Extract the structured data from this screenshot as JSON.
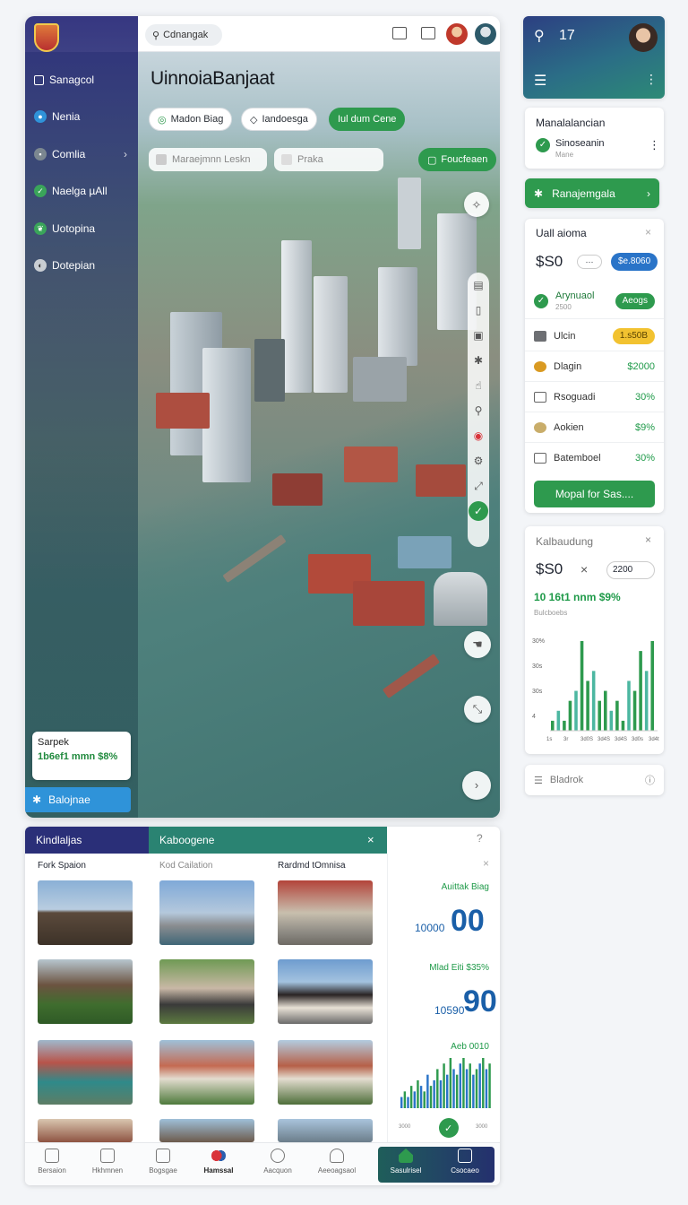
{
  "sidebar": {
    "items": [
      {
        "label": "Sanagcol",
        "icon": "home-icon"
      },
      {
        "label": "Nenia",
        "icon": "user-icon"
      },
      {
        "label": "Comlia",
        "icon": "grid-icon"
      },
      {
        "label": "Naelga µAll",
        "icon": "shield-icon"
      },
      {
        "label": "Uotopina",
        "icon": "leaf-icon"
      },
      {
        "label": "Dotepian",
        "icon": "globe-icon"
      }
    ],
    "promo_title": "Sarpek",
    "promo_value": "1b6ef1 mmn $8%",
    "button_label": "Balojnae"
  },
  "topbar": {
    "search_placeholder": "Cdnangak"
  },
  "main": {
    "title": "UinnoiaBanjaat",
    "chips": [
      "Madon Biag",
      "Iandoesga",
      "Iul dum Cene"
    ],
    "field1": "Maraejmnn Leskn",
    "field2": "Praka",
    "action_button": "Foucfeaen"
  },
  "right": {
    "top_title": "17",
    "card1_title": "Manalalancian",
    "card1_item": "Sinoseanin",
    "card1_sub": "Mane",
    "green_button": "Ranajemgala",
    "list_title": "Uall aioma",
    "price": "$S0",
    "price_badge": "$e.8060",
    "rows": [
      {
        "label": "Arynuaol",
        "sub": "2500",
        "value": "Aeogs",
        "type": "pill-green"
      },
      {
        "label": "Ulcin",
        "value": "1.s50B",
        "type": "pill-yellow"
      },
      {
        "label": "Dlagin",
        "value": "$2000",
        "type": "text"
      },
      {
        "label": "Rsoguadi",
        "value": "30%",
        "type": "text"
      },
      {
        "label": "Aokien",
        "value": "$9%",
        "type": "text"
      },
      {
        "label": "Batemboel",
        "value": "30%",
        "type": "text"
      }
    ],
    "cta": "Mopal for Sas....",
    "chart_card_title": "Kalbaudung",
    "chart_price": "$S0",
    "chart_input": "2200",
    "chart_value": "10 16t1 nnm $9%",
    "chart_sub": "Bulcboebs",
    "footer_label": "Bladrok"
  },
  "bottom": {
    "tab1": "Kindlaljas",
    "tab2": "Kaboogene",
    "col1_title": "Fork Spaion",
    "col2_title": "Kod Cailation",
    "col3_title": "Rardmd tOmnisa",
    "stat1_label": "Auittak Biag",
    "stat1_small": "10000",
    "stat1_big": "00",
    "stat2_label": "Mlad Eiti $35%",
    "stat2_small": "10590",
    "stat2_big": "90",
    "stat3_label": "Aeb 0010",
    "nav": [
      "Bersaion",
      "Hkhmnen",
      "Bogsgae",
      "Hamssal",
      "Aacquon",
      "Aeeoagsaol",
      "Sasulrisel",
      "Csocaeo"
    ]
  },
  "chart_data": [
    {
      "type": "bar",
      "title": "",
      "y_ticks": [
        "30%",
        "30s",
        "30s",
        "4"
      ],
      "x_ticks": [
        "1s",
        "3r",
        "3d0S",
        "3d4S",
        "3d4S",
        "3d0s",
        "3d4t"
      ],
      "values": [
        1,
        2,
        1,
        3,
        4,
        9,
        5,
        6,
        3,
        4,
        2,
        3,
        1,
        5,
        4,
        8,
        6,
        9
      ]
    },
    {
      "type": "bar",
      "title": "Aeb 0010",
      "x_ticks": [
        "3000",
        "3000"
      ],
      "values": [
        2,
        3,
        2,
        4,
        3,
        5,
        4,
        3,
        6,
        4,
        5,
        7,
        5,
        8,
        6,
        9,
        7,
        6,
        8,
        9,
        7,
        8,
        6,
        7,
        8,
        9,
        7,
        8
      ]
    }
  ],
  "colors": {
    "accent_green": "#2e9a4e",
    "accent_blue": "#2f93d9",
    "sidebar_dark": "#2b2c7a",
    "stat_blue": "#1a5fa8"
  }
}
